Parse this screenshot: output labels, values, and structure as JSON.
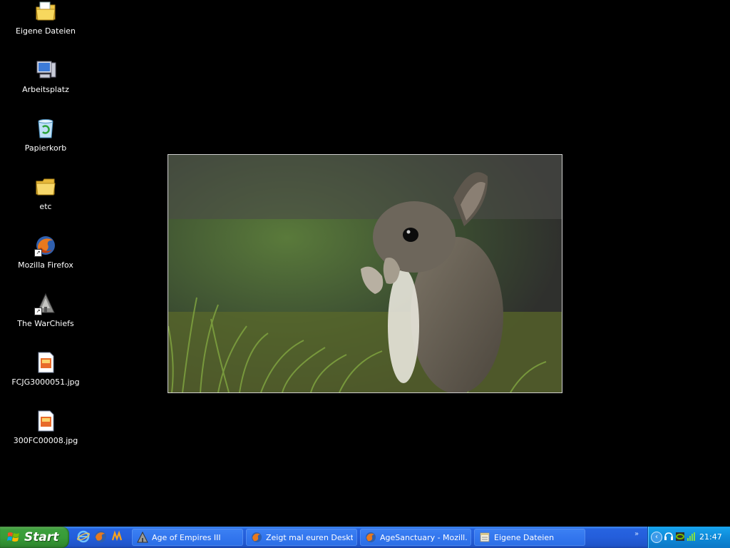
{
  "desktop": {
    "icons": [
      {
        "label": "Eigene Dateien",
        "icon": "my-documents-folder-icon"
      },
      {
        "label": "Arbeitsplatz",
        "icon": "my-computer-icon"
      },
      {
        "label": "Papierkorb",
        "icon": "recycle-bin-icon"
      },
      {
        "label": "etc",
        "icon": "folder-icon"
      },
      {
        "label": "Mozilla Firefox",
        "icon": "firefox-icon"
      },
      {
        "label": "The WarChiefs",
        "icon": "warchiefs-game-icon"
      },
      {
        "label": "FCJG3000051.jpg",
        "icon": "jpg-file-icon"
      },
      {
        "label": "300FC00008.jpg",
        "icon": "jpg-file-icon"
      }
    ],
    "wallpaper": {
      "subject": "rabbit-photo"
    }
  },
  "taskbar": {
    "start_label": "Start",
    "quick_launch": [
      "internet-explorer-icon",
      "firefox-icon",
      "media-icon"
    ],
    "buttons": [
      {
        "label": "Age of Empires III",
        "icon": "aoe3-icon"
      },
      {
        "label": "Zeigt mal euren Deskt...",
        "icon": "firefox-icon"
      },
      {
        "label": "AgeSanctuary - Mozill...",
        "icon": "firefox-icon"
      },
      {
        "label": "Eigene Dateien",
        "icon": "explorer-window-icon"
      }
    ],
    "overflow_label": "»",
    "tray": {
      "expand_label": "‹",
      "icons": [
        "headset-icon",
        "nvidia-icon",
        "network-icon"
      ],
      "clock": "21:47"
    }
  },
  "colors": {
    "taskbar_blue": "#245edb",
    "start_green": "#389c38",
    "tray_blue": "#0f8ad8",
    "desktop_bg": "#000000"
  }
}
